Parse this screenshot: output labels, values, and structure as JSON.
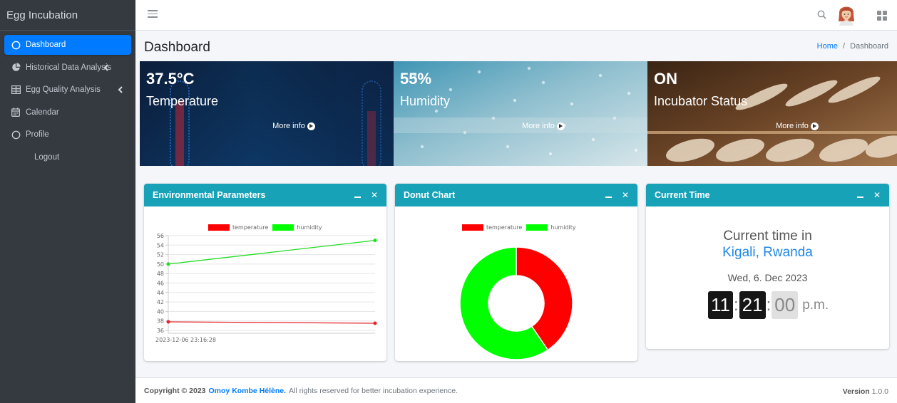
{
  "brand": "Egg Incubation",
  "sidebar": {
    "items": [
      {
        "label": "Dashboard",
        "icon": "circle-icon",
        "active": true
      },
      {
        "label": "Historical Data Analysis",
        "icon": "chart-pie-icon",
        "arrow": true
      },
      {
        "label": "Egg Quality Analysis",
        "icon": "table-icon",
        "arrow": true
      },
      {
        "label": "Calendar",
        "icon": "calendar-icon"
      },
      {
        "label": "Profile",
        "icon": "circle-icon"
      },
      {
        "label": "Logout",
        "icon": ""
      }
    ]
  },
  "header": {
    "title": "Dashboard",
    "breadcrumb": {
      "home": "Home",
      "separator": "/",
      "current": "Dashboard"
    }
  },
  "tiles": [
    {
      "value": "37.5°C",
      "label": "Temperature",
      "link": "More info"
    },
    {
      "value": "55%",
      "label": "Humidity",
      "link": "More info"
    },
    {
      "value": "ON",
      "label": "Incubator Status",
      "link": "More info"
    }
  ],
  "cards": {
    "env": {
      "title": "Environmental Parameters"
    },
    "donut": {
      "title": "Donut Chart"
    },
    "time": {
      "title": "Current Time",
      "heading": "Current time in",
      "city": "Kigali, Rwanda",
      "date": "Wed, 6. Dec 2023",
      "hours": "11",
      "minutes": "21",
      "seconds": "00",
      "ampm": "p.m.",
      "sep": ":"
    }
  },
  "chart_data": [
    {
      "type": "line",
      "x": [
        "2023-12-06 23:16:28",
        ""
      ],
      "series": [
        {
          "name": "temperature",
          "color": "#e3242b",
          "values": [
            37.8,
            37.5
          ]
        },
        {
          "name": "humidity",
          "color": "#22dd22",
          "values": [
            50,
            55
          ]
        }
      ],
      "ylim": [
        36,
        56
      ],
      "yticks": [
        "56",
        "54",
        "52",
        "50",
        "48",
        "46",
        "44",
        "42",
        "40",
        "38",
        "36"
      ],
      "legend": "top"
    },
    {
      "type": "pie",
      "categories": [
        "temperature",
        "humidity"
      ],
      "values": [
        37.5,
        55
      ],
      "colors": [
        "#ff0000",
        "#00ff00"
      ],
      "legend": "top"
    }
  ],
  "footer": {
    "copyright": "Copyright © 2023",
    "author": "Omoy Kombe Hélène.",
    "rights": "All rights reserved for better incubation experience.",
    "version_label": "Version",
    "version": "1.0.0"
  }
}
